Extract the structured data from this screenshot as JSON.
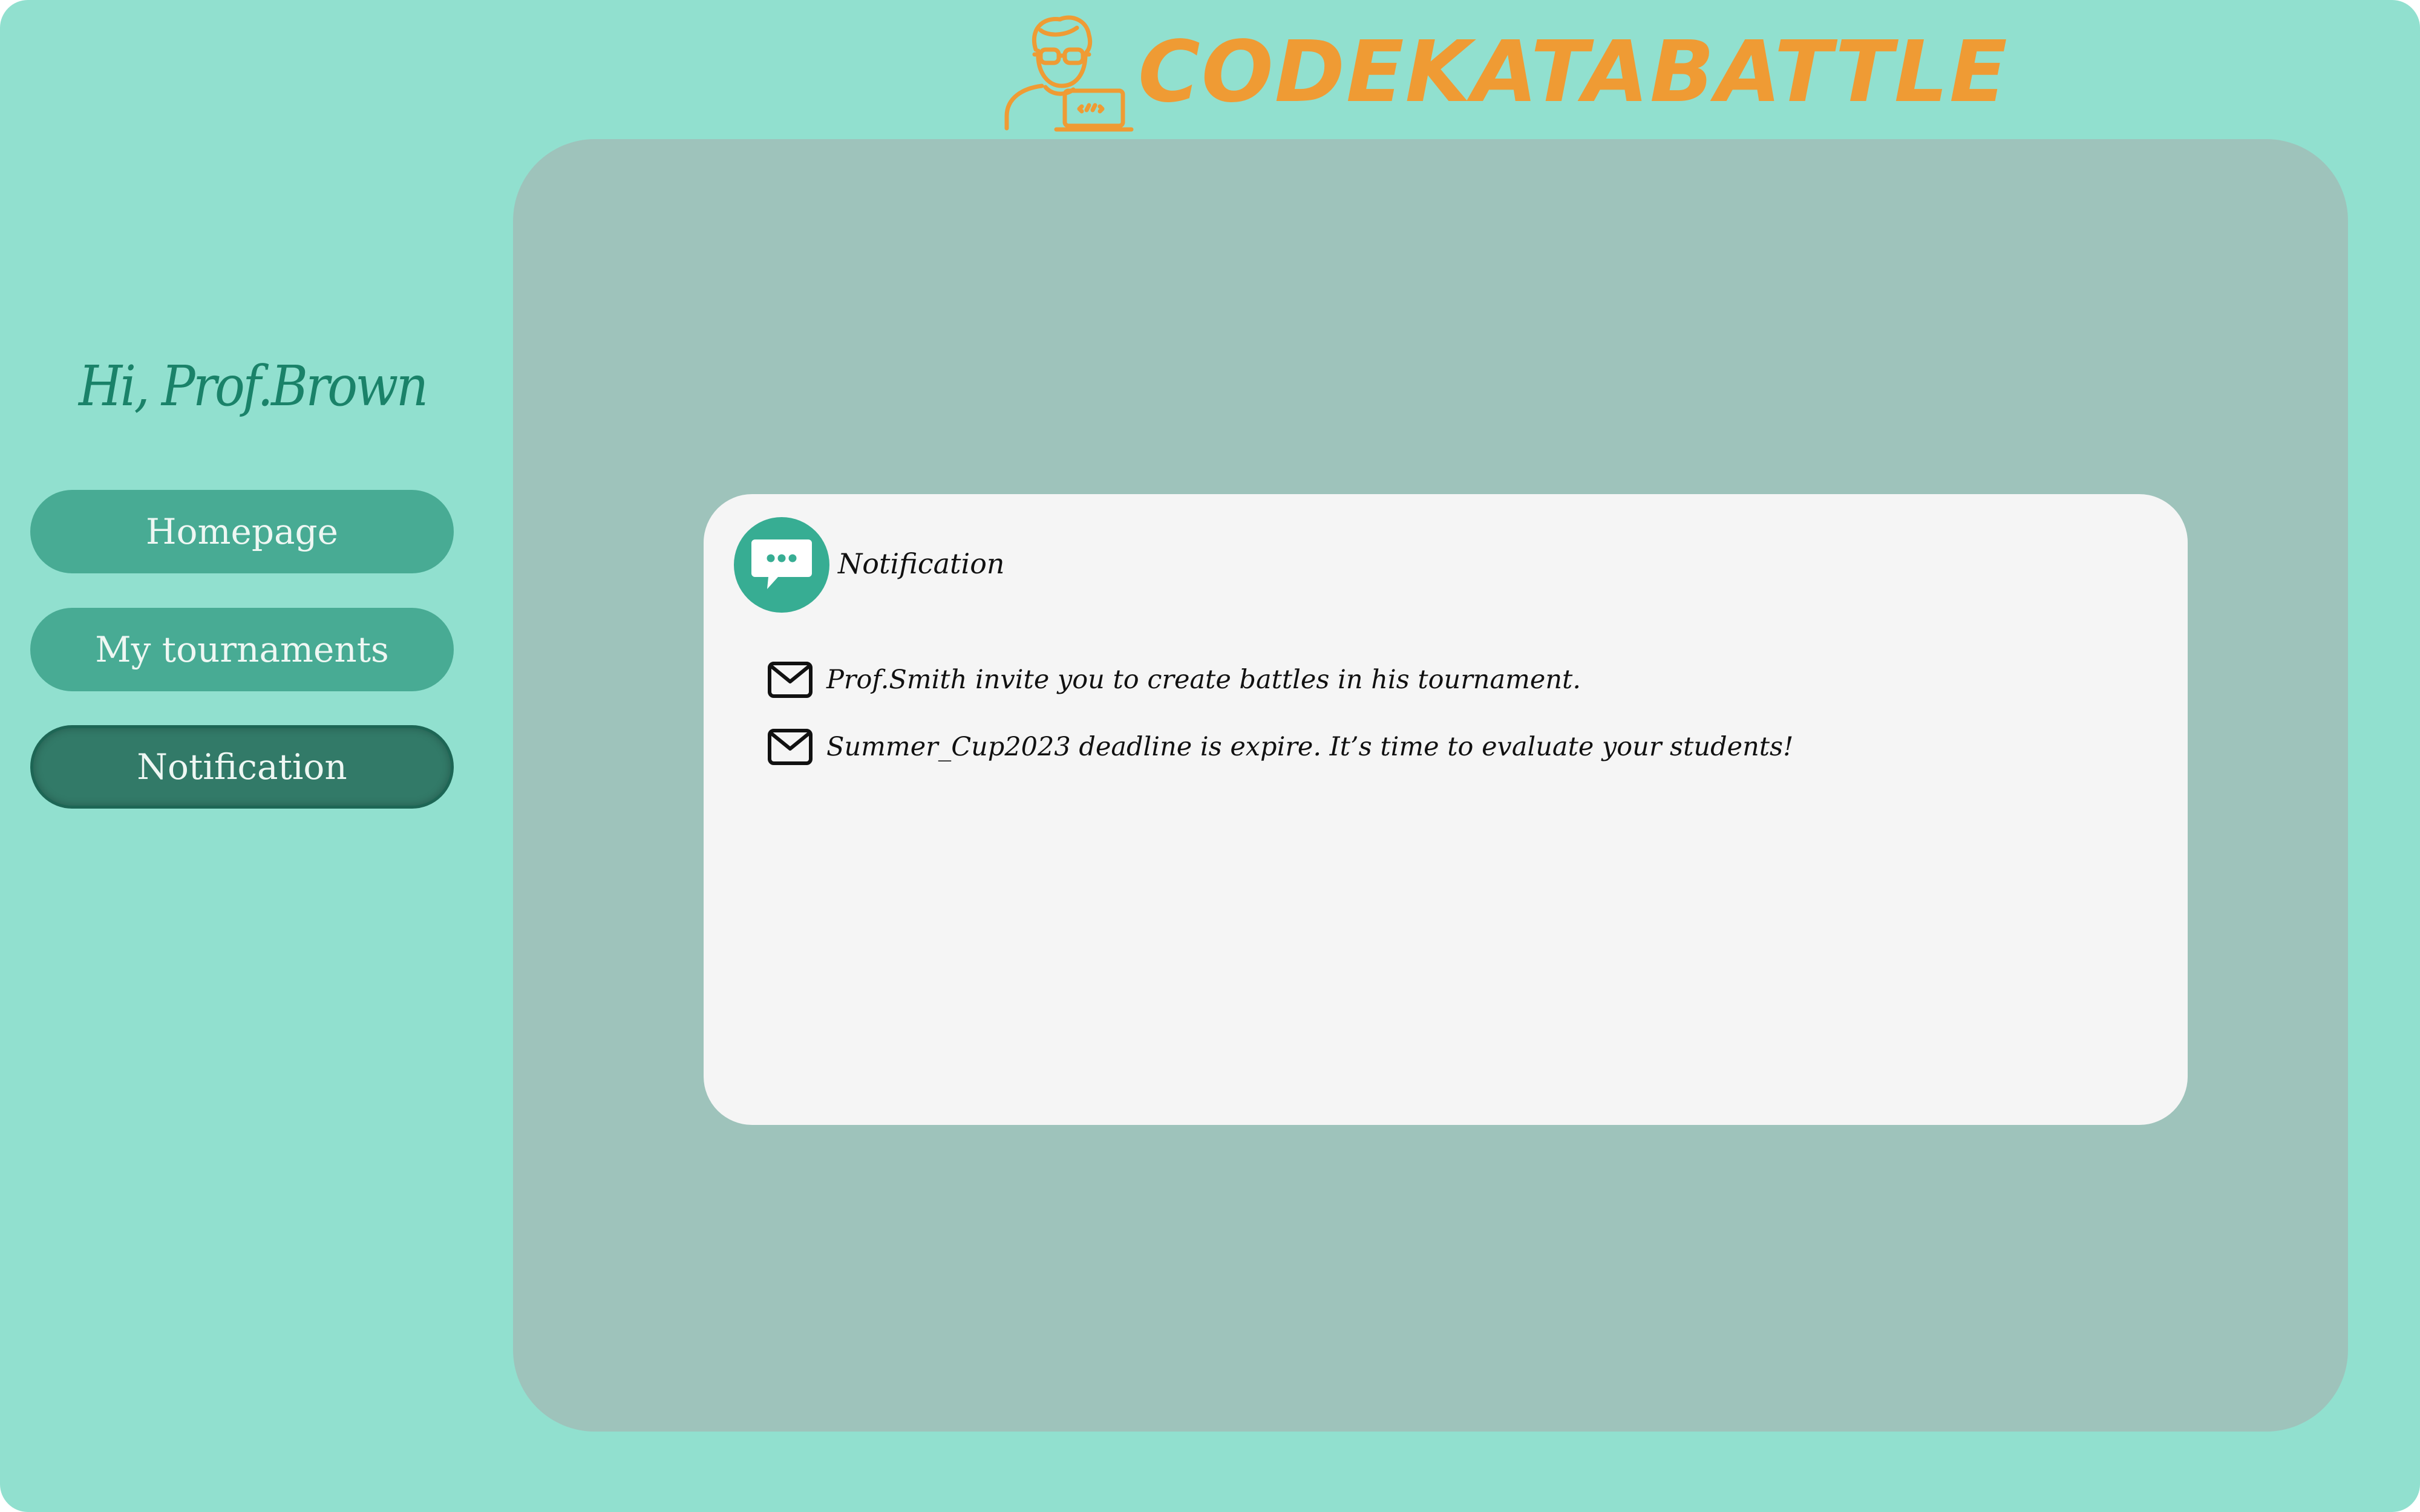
{
  "brand": {
    "name": "CODEKATABATTLE",
    "logo_icon": "developer-with-laptop-icon"
  },
  "sidebar": {
    "greeting": "Hi, Prof.Brown",
    "items": [
      {
        "label": "Homepage",
        "active": false
      },
      {
        "label": "My tournaments",
        "active": false
      },
      {
        "label": "Notification",
        "active": true
      }
    ]
  },
  "notification_card": {
    "title": "Notification",
    "icon": "chat-bubble-icon",
    "items": [
      {
        "icon": "envelope-icon",
        "text": "Prof.Smith invite you to create battles in his tournament."
      },
      {
        "icon": "envelope-icon",
        "text": "Summer_Cup2023 deadline is expire. It’s time to evaluate your students!"
      }
    ]
  },
  "colors": {
    "background": "#91e0cf",
    "panel": "#9ec3bb",
    "card": "#f5f5f5",
    "accent_orange": "#ef9b34",
    "nav_button": "#48ab94",
    "nav_button_active": "#327a68",
    "greeting_text": "#1a8269",
    "icon_circle": "#37ad93"
  }
}
